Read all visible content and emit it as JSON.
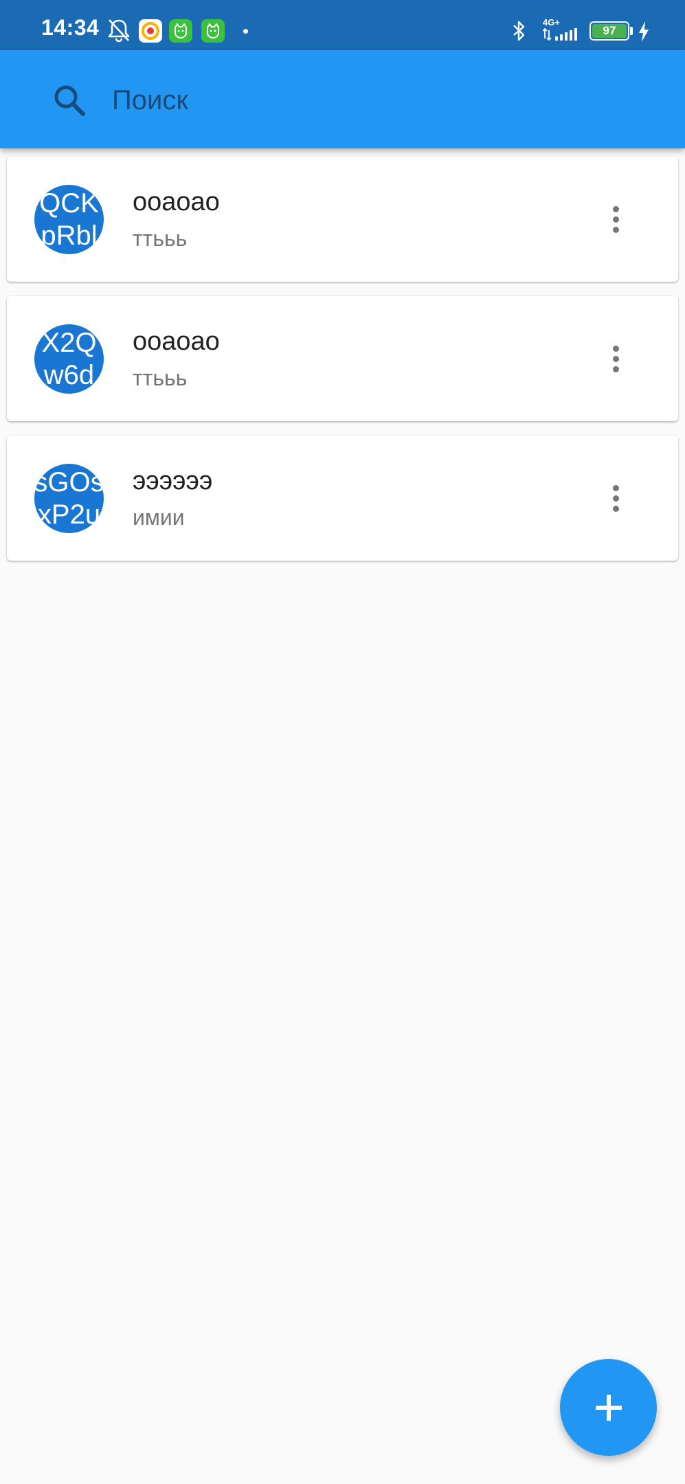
{
  "status_bar": {
    "time": "14:34",
    "network": "4G+",
    "battery": "97",
    "icons": [
      "bell-off-icon",
      "music-app-icon",
      "cat-app-icon",
      "cat-app-icon",
      "dot-icon",
      "bluetooth-icon",
      "signal-icon",
      "battery-icon",
      "charging-icon"
    ]
  },
  "search": {
    "placeholder": "Поиск",
    "icon": "search-icon"
  },
  "colors": {
    "app_bar": "#2196f3",
    "status_bar": "#1b6ab4",
    "avatar": "#1976d2",
    "fab": "#2196f3",
    "background": "#fafafa"
  },
  "items": [
    {
      "avatar_line1": "QCK",
      "avatar_line2": "pRbl",
      "title": "ооаоао",
      "subtitle": "ттььь"
    },
    {
      "avatar_line1": "X2Q",
      "avatar_line2": "w6d",
      "title": "ооаоао",
      "subtitle": "ттььь"
    },
    {
      "avatar_line1": "sGOs",
      "avatar_line2": "xP2u",
      "title": "ээээээ",
      "subtitle": "имии"
    }
  ],
  "fab": {
    "icon": "plus-icon"
  }
}
